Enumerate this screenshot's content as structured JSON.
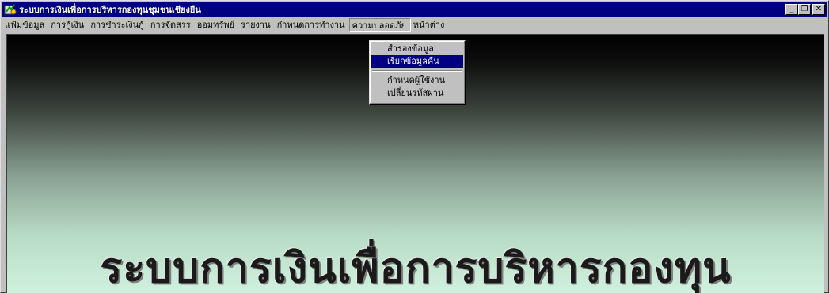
{
  "window": {
    "title": "ระบบการเงินเพื่อการบริหารกองทุนชุมชนเชียงยืน",
    "icon": "app-icon",
    "controls": {
      "minimize": "_",
      "maximize": "❐",
      "close": "✕"
    }
  },
  "menubar": {
    "items": [
      "แฟ้มข้อมูล",
      "การกู้เงิน",
      "การชำระเงินกู้",
      "การจัดสรร",
      "ออมทรัพย์",
      "รายงาน",
      "กำหนดการทำงาน",
      "ความปลอดภัย",
      "หน้าต่าง"
    ],
    "open_index": 7
  },
  "dropdown": {
    "items": [
      "สำรองข้อมูล",
      "เรียกข้อมูลคืน",
      "กำหนดผู้ใช้งาน",
      "เปลี่ยนรหัสผ่าน"
    ],
    "selected_index": 1
  },
  "banner": {
    "text": "ระบบการเงินเพื่อการบริหารกองทุน"
  },
  "colors": {
    "titlebar": "#000080",
    "highlight": "#000080",
    "chrome": "#c0c0c0"
  }
}
